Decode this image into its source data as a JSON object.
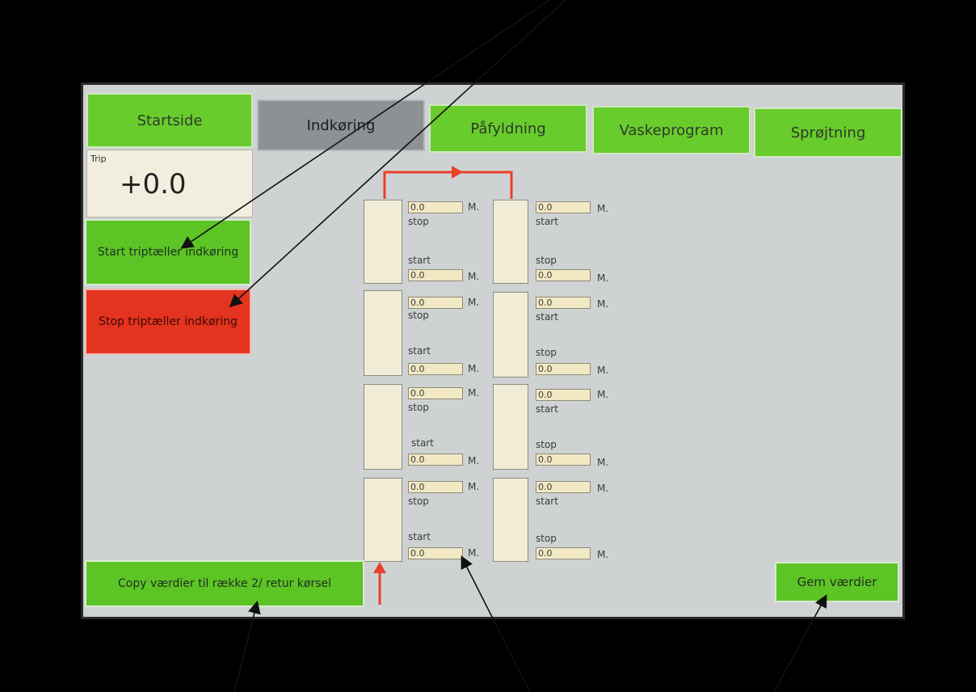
{
  "tabs": [
    {
      "label": "Startside"
    },
    {
      "label": "Indkøring"
    },
    {
      "label": "Påfyldning"
    },
    {
      "label": "Vaskeprogram"
    },
    {
      "label": "Sprøjtning"
    }
  ],
  "trip": {
    "label": "Trip",
    "value": "+0.0"
  },
  "buttons": {
    "start_trip": "Start triptæller indkøring",
    "stop_trip": "Stop triptæller indkøring",
    "copy": "Copy værdier til række 2/ retur kørsel",
    "save": "Gem værdier"
  },
  "unit": "M.",
  "labels": {
    "stop": "stop",
    "start": "start"
  },
  "rows": [
    {
      "left_top": "0.0",
      "left_bottom": "0.0",
      "right_top": "0.0",
      "right_bottom": "0.0"
    },
    {
      "left_top": "0.0",
      "left_bottom": "0.0",
      "right_top": "0.0",
      "right_bottom": "0.0"
    },
    {
      "left_top": "0.0",
      "left_bottom": "0.0",
      "right_top": "0.0",
      "right_bottom": "0.0"
    },
    {
      "left_top": "0.0",
      "left_bottom": "0.0",
      "right_top": "0.0",
      "right_bottom": "0.0"
    }
  ],
  "colors": {
    "tab_green": "#69cc2d",
    "tab_active": "#8c9194",
    "stop_red": "#e4331f",
    "arrow_red": "#e8402a"
  }
}
